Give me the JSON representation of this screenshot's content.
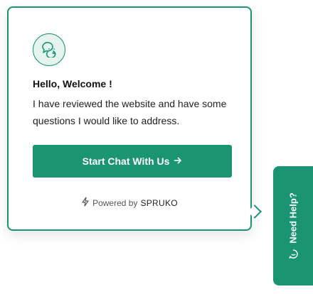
{
  "widget": {
    "greeting": "Hello, Welcome !",
    "message": "I have reviewed the website and have some questions I would like to address.",
    "cta_label": "Start Chat With Us",
    "powered_label": "Powered by",
    "powered_brand": "SPRUKO",
    "avatar_icon": "chat-bubbles-icon",
    "cta_icon": "arrow-right-icon",
    "powered_icon": "lightning-icon"
  },
  "help_tab": {
    "label": "Need Help?",
    "icon": "chat-circle-icon"
  },
  "colors": {
    "accent": "#1b9474",
    "accent_light": "#e6f4ef",
    "text_dark": "#111111",
    "text_muted": "#555555"
  }
}
